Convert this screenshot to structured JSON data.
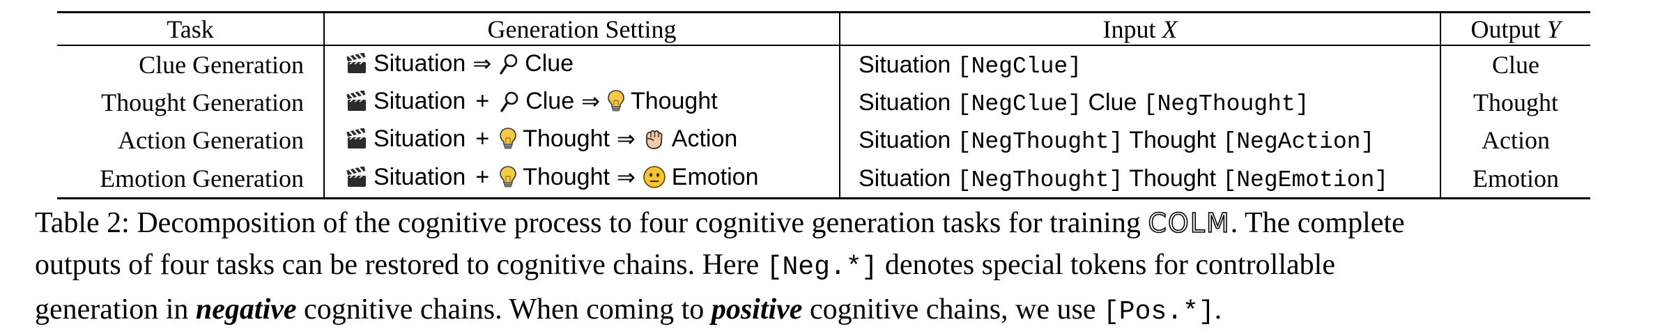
{
  "table": {
    "headers": {
      "task": "Task",
      "setting": "Generation Setting",
      "input_prefix": "Input ",
      "input_var": "X",
      "output_prefix": "Output ",
      "output_var": "Y"
    },
    "arrow": "⇒",
    "plus": "+",
    "rows": [
      {
        "task": "Clue Generation",
        "s1": "Situation",
        "s2": "Clue",
        "s3": "",
        "in_1": "Situation ",
        "in_tok1": "[NegClue]",
        "in_2": "",
        "in_tok2": "",
        "output": "Clue"
      },
      {
        "task": "Thought Generation",
        "s1": "Situation",
        "s2": "Clue",
        "s3": "Thought",
        "in_1": "Situation ",
        "in_tok1": "[NegClue]",
        "in_2": " Clue ",
        "in_tok2": "[NegThought]",
        "output": "Thought"
      },
      {
        "task": "Action Generation",
        "s1": "Situation",
        "s2": "Thought",
        "s3": "Action",
        "in_1": "Situation ",
        "in_tok1": "[NegThought]",
        "in_2": " Thought ",
        "in_tok2": "[NegAction]",
        "output": "Action"
      },
      {
        "task": "Emotion Generation",
        "s1": "Situation",
        "s2": "Thought",
        "s3": "Emotion",
        "in_1": "Situation ",
        "in_tok1": "[NegThought]",
        "in_2": " Thought ",
        "in_tok2": "[NegEmotion]",
        "output": "Emotion"
      }
    ],
    "icons": {
      "situation": "clapper-board-icon",
      "clue": "magnifying-glass-icon",
      "thought": "light-bulb-icon",
      "action": "raised-fist-icon",
      "emotion": "neutral-face-icon"
    }
  },
  "caption": {
    "l1_a": "Table 2: Decomposition of the cognitive process to four cognitive generation tasks for training ",
    "l1_colm": "COLM",
    "l1_b": ". The complete",
    "l2_a": "outputs of four tasks can be restored to cognitive chains. Here ",
    "l2_tok": "[Neg.*]",
    "l2_b": " denotes special tokens for controllable",
    "l3_a": "generation in ",
    "l3_neg": "negative",
    "l3_b": " cognitive chains. When coming to ",
    "l3_pos": "positive",
    "l3_c": " cognitive chains, we use ",
    "l3_tok": "[Pos.*]",
    "l3_d": "."
  },
  "colors": {
    "text": "#000000",
    "clapper": "#2b2b2b",
    "bulb": "#f7c948",
    "face": "#f5c431",
    "fist": "#f3c9a8"
  }
}
